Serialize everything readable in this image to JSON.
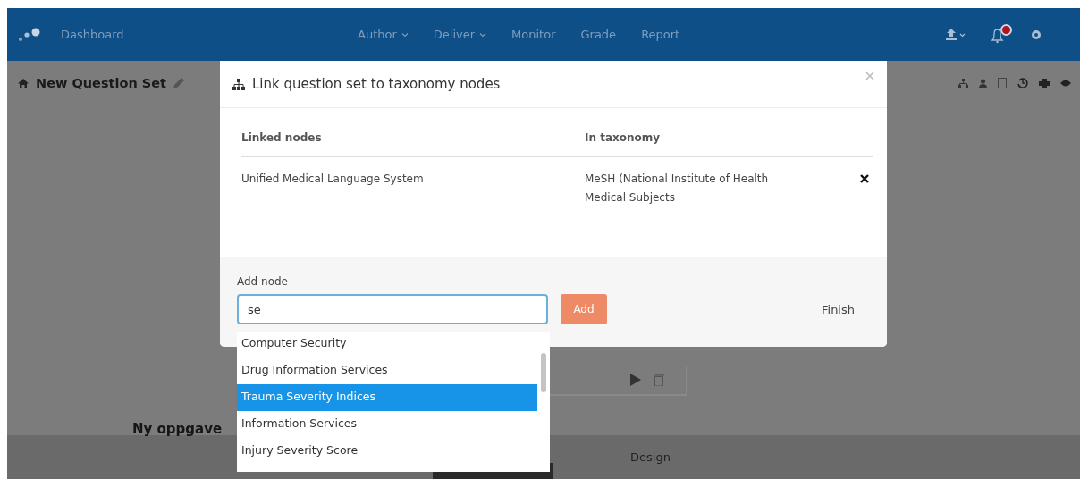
{
  "navbar": {
    "brand": "Dashboard",
    "menu": [
      {
        "label": "Author",
        "has_menu": true
      },
      {
        "label": "Deliver",
        "has_menu": true
      },
      {
        "label": "Monitor",
        "has_menu": false
      },
      {
        "label": "Grade",
        "has_menu": false
      },
      {
        "label": "Report",
        "has_menu": false
      }
    ],
    "notification": true
  },
  "page": {
    "title": "New Question Set",
    "task_title": "Ny oppgave",
    "bottom_tab": "Design"
  },
  "modal": {
    "title": "Link question set to taxonomy nodes",
    "columns": [
      "Linked nodes",
      "In taxonomy"
    ],
    "rows": [
      {
        "node": "Unified Medical Language System",
        "taxonomy": "MeSH (National Institute of Health Medical Subjects"
      }
    ],
    "add_label": "Add node",
    "input_value": "se",
    "add_button": "Add",
    "finish_button": "Finish",
    "suggestions": [
      {
        "label": "Computer Security",
        "selected": false
      },
      {
        "label": "Drug Information Services",
        "selected": false
      },
      {
        "label": "Trauma Severity Indices",
        "selected": true
      },
      {
        "label": "Information Services",
        "selected": false
      },
      {
        "label": "Injury Severity Score",
        "selected": false
      }
    ]
  }
}
